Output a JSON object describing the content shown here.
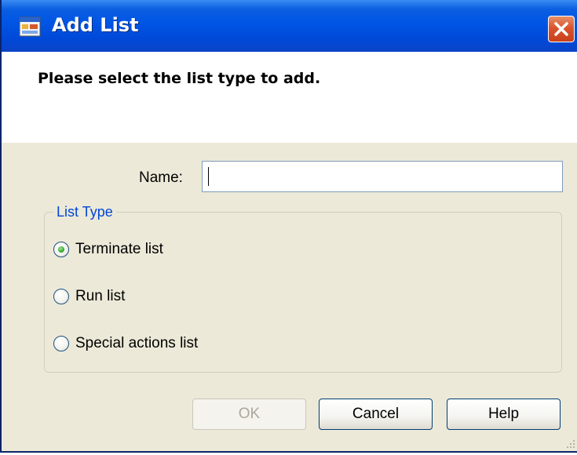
{
  "window": {
    "title": "Add List",
    "icon": "app-window-icon",
    "close_icon": "close-icon"
  },
  "header": {
    "prompt": "Please select the list type to add."
  },
  "form": {
    "name_label": "Name:",
    "name_value": ""
  },
  "list_type": {
    "legend": "List Type",
    "options": [
      {
        "label": "Terminate list",
        "selected": true
      },
      {
        "label": "Run list",
        "selected": false
      },
      {
        "label": "Special actions list",
        "selected": false
      }
    ]
  },
  "buttons": {
    "ok": "OK",
    "ok_enabled": false,
    "cancel": "Cancel",
    "help": "Help"
  },
  "colors": {
    "titlebar": "#0055e5",
    "dialog_bg": "#ece9d8",
    "group_legend": "#0046d5",
    "close_button": "#d9552d"
  }
}
